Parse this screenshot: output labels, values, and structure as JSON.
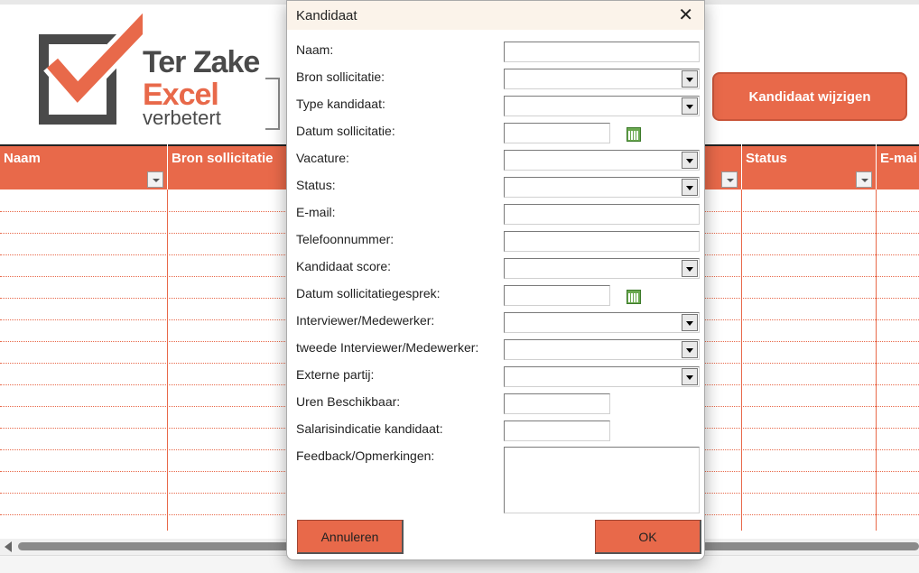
{
  "logo": {
    "line1": "Ter Zake",
    "line2": "Excel",
    "line3": "verbetert"
  },
  "action_button": {
    "label": "Kandidaat wijzigen"
  },
  "table": {
    "headers": [
      "Naam",
      "Bron sollicitatie",
      "Status",
      "E-mai"
    ]
  },
  "dialog": {
    "title": "Kandidaat",
    "close_glyph": "✕",
    "fields": [
      {
        "label": "Naam:",
        "type": "text",
        "value": ""
      },
      {
        "label": "Bron sollicitatie:",
        "type": "combo",
        "value": ""
      },
      {
        "label": "Type kandidaat:",
        "type": "combo",
        "value": ""
      },
      {
        "label": "Datum sollicitatie:",
        "type": "date",
        "value": ""
      },
      {
        "label": "Vacature:",
        "type": "combo",
        "value": ""
      },
      {
        "label": "Status:",
        "type": "combo",
        "value": ""
      },
      {
        "label": "E-mail:",
        "type": "text",
        "value": ""
      },
      {
        "label": "Telefoonnummer:",
        "type": "text",
        "value": ""
      },
      {
        "label": "Kandidaat score:",
        "type": "combo",
        "value": ""
      },
      {
        "label": "Datum sollicitatiegesprek:",
        "type": "date",
        "value": ""
      },
      {
        "label": "Interviewer/Medewerker:",
        "type": "combo",
        "value": ""
      },
      {
        "label": "tweede Interviewer/Medewerker:",
        "type": "combo",
        "value": ""
      },
      {
        "label": "Externe partij:",
        "type": "combo",
        "value": ""
      },
      {
        "label": "Uren Beschikbaar:",
        "type": "short",
        "value": ""
      },
      {
        "label": "Salarisindicatie kandidaat:",
        "type": "short",
        "value": ""
      },
      {
        "label": "Feedback/Opmerkingen:",
        "type": "textarea",
        "value": ""
      }
    ],
    "cancel_label": "Annuleren",
    "ok_label": "OK"
  },
  "colors": {
    "accent": "#e8694a",
    "title_bar": "#fbf3ea",
    "calendar": "#6aa84f"
  }
}
